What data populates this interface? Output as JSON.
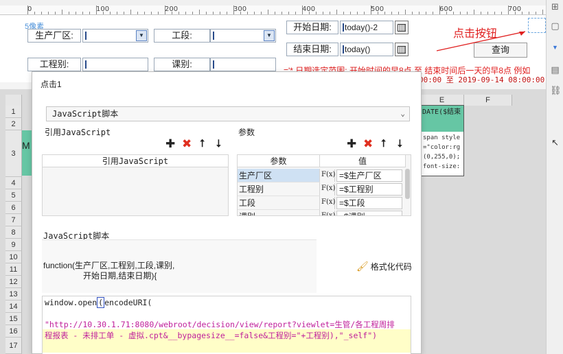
{
  "ruler": {
    "marks": [
      "0",
      "100",
      "200",
      "300",
      "400",
      "500",
      "600",
      "700"
    ]
  },
  "form": {
    "pixel_label": "5像素",
    "labels": {
      "factory": "生产厂区:",
      "section": "工段:",
      "category": "工程别:",
      "class": "课别:"
    },
    "start_label": "开始日期:",
    "start_value": "today()-2",
    "end_label": "结束日期:",
    "end_value": "today()",
    "query_button": "查询",
    "annotation": "点击按钮",
    "hint": "='* 日期选定范围: 开始时间的早8点 至 结束时间后一天的早8点 例如",
    "hint_range": "00:00 至 2019-09-14 08:00:00"
  },
  "sheet": {
    "rows": [
      "1 (H)",
      "2 (H)",
      "3",
      "4",
      "5",
      "6",
      "7",
      "8",
      "9",
      "10",
      "11",
      "12",
      "13",
      "14",
      "15",
      "16",
      "17"
    ],
    "col_e": "E",
    "col_f": "F",
    "cell_d_header": "DATE($结束",
    "cell_d_lines": [
      "span style",
      "=\"color:rg",
      "(0,255,0);",
      "font-size:"
    ],
    "cell_a_text": "M"
  },
  "dialog": {
    "title": "点击1",
    "type_select": "JavaScript脚本",
    "ref_label": "引用JavaScript",
    "ref_column": "引用JavaScript",
    "param_label": "参数",
    "param_columns": [
      "参数",
      "值"
    ],
    "params": [
      {
        "name": "生产厂区",
        "fx": "F(x)",
        "value": "=$生产厂区"
      },
      {
        "name": "工程别",
        "fx": "F(x)",
        "value": "=$工程别"
      },
      {
        "name": "工段",
        "fx": "F(x)",
        "value": "=$工段"
      },
      {
        "name": "课别",
        "fx": "F(x)",
        "value": "=$课别"
      }
    ],
    "script_label": "JavaScript脚本",
    "signature_line1": "function(生产厂区,工程别,工段,课别,",
    "signature_line2": "开始日期,结束日期){",
    "format_button": "格式化代码",
    "code_line1_a": "window.open",
    "code_line1_paren": "(",
    "code_line1_b": "encodeURI(",
    "code_line3": "\"http://10.30.1.71:8080/webroot/decision/view/report?viewlet=生管/各工程周排",
    "code_line4": "程报表 - 未排工单 - 虚拟.cpt&__bypagesize__=false&工程别=\"+工程别),\"_self\")"
  },
  "colors": {
    "accent_green": "#66c6a4",
    "annotation_red": "#e02020",
    "selection_blue": "#cfe1f3",
    "string_magenta": "#c0209b"
  }
}
